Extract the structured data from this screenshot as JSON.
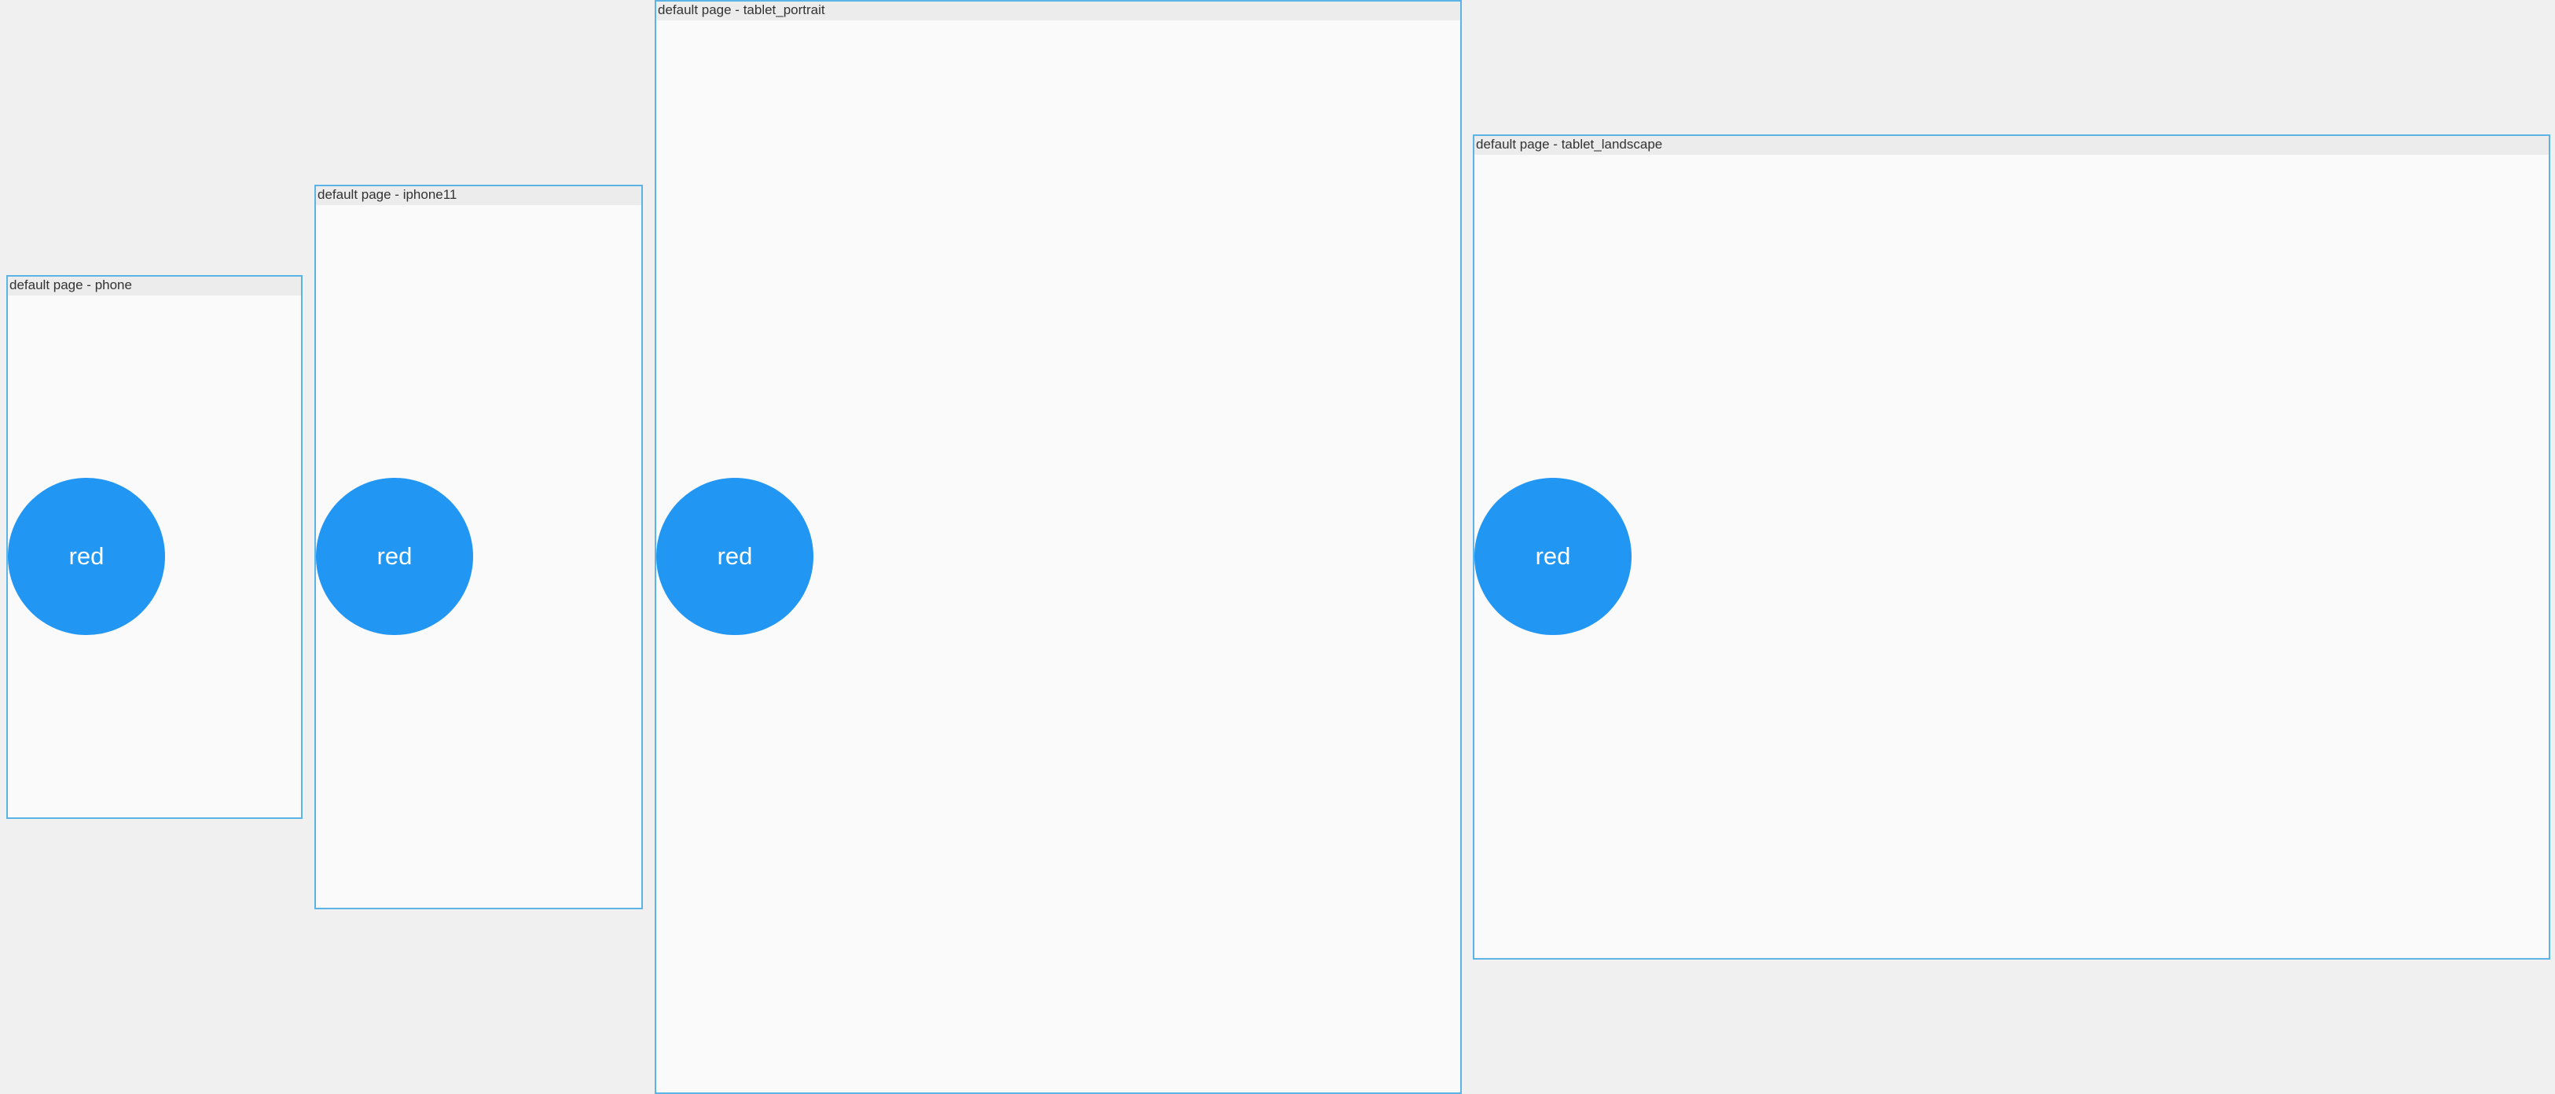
{
  "frames": [
    {
      "title": "default page - phone",
      "button_label": "red"
    },
    {
      "title": "default page - iphone11",
      "button_label": "red"
    },
    {
      "title": "default page - tablet_portrait",
      "button_label": "red"
    },
    {
      "title": "default page - tablet_landscape",
      "button_label": "red"
    }
  ],
  "colors": {
    "background": "#f0f0f0",
    "frame_border": "#5bb3e6",
    "frame_surface": "#fafafa",
    "title_bar": "#ececec",
    "button": "#2196f3",
    "button_text": "#ffffff"
  }
}
